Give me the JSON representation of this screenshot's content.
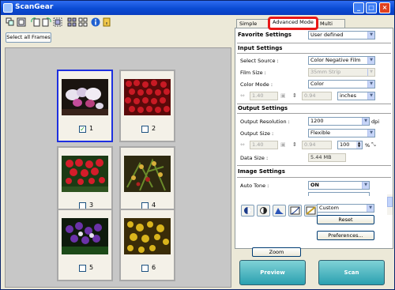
{
  "window": {
    "title": "ScanGear"
  },
  "left": {
    "toolbar_icons": [
      "thumbnail-icon",
      "zoom-icon",
      "rotate-left-icon",
      "rotate-right-icon",
      "crop-icon",
      "multi-crop-icon",
      "info-icon",
      "help-icon"
    ],
    "select_all_label": "Select all Frames",
    "frames": [
      {
        "number": "1",
        "checked": true,
        "selected": true,
        "photo": "orchid"
      },
      {
        "number": "2",
        "checked": false,
        "selected": false,
        "photo": "strawberries"
      },
      {
        "number": "3",
        "checked": false,
        "selected": false,
        "photo": "red-flowers"
      },
      {
        "number": "4",
        "checked": false,
        "selected": false,
        "photo": "vine"
      },
      {
        "number": "5",
        "checked": false,
        "selected": false,
        "photo": "purple-flowers"
      },
      {
        "number": "6",
        "checked": false,
        "selected": false,
        "photo": "yellow-flowers"
      }
    ]
  },
  "tabs": [
    {
      "label": "Simple Mode",
      "active": false
    },
    {
      "label": "Advanced Mode",
      "active": true
    },
    {
      "label": "Multi Scan",
      "active": false
    }
  ],
  "favorite": {
    "label": "Favorite Settings",
    "value": "User defined"
  },
  "input": {
    "title": "Input Settings",
    "select_source_label": "Select Source :",
    "select_source_value": "Color Negative Film",
    "film_size_label": "Film Size :",
    "film_size_value": "35mm Strip",
    "color_mode_label": "Color Mode :",
    "color_mode_value": "Color",
    "width_value": "1.40",
    "height_value": "0.94",
    "unit_value": "inches"
  },
  "output": {
    "title": "Output Settings",
    "resolution_label": "Output Resolution :",
    "resolution_value": "1200",
    "resolution_unit": "dpi",
    "size_label": "Output Size :",
    "size_value": "Flexible",
    "width_value": "1.40",
    "height_value": "0.94",
    "scale_value": "100",
    "percent": "%",
    "data_size_label": "Data Size :",
    "data_size_value": "5.44 MB"
  },
  "image": {
    "title": "Image Settings",
    "auto_tone_label": "Auto Tone :",
    "auto_tone_value": "ON",
    "preset_value": "Custom",
    "reset_label": "Reset",
    "preferences_label": "Preferences..."
  },
  "actions": {
    "zoom_label": "Zoom",
    "preview_label": "Preview",
    "scan_label": "Scan"
  }
}
